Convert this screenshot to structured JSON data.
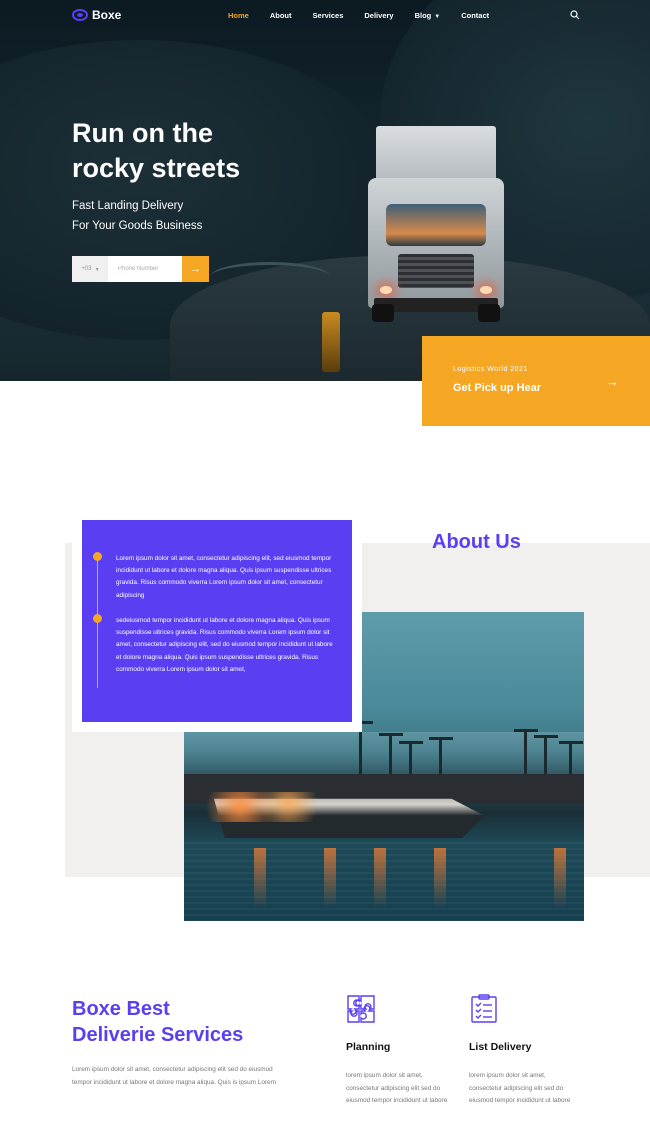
{
  "brand": {
    "name": "Boxe",
    "accent": "#5a3ff2",
    "highlight": "#f5a623"
  },
  "nav": {
    "items": [
      {
        "label": "Home",
        "active": true
      },
      {
        "label": "About"
      },
      {
        "label": "Services"
      },
      {
        "label": "Delivery"
      },
      {
        "label": "Blog",
        "dropdown": true
      },
      {
        "label": "Contact"
      }
    ],
    "search_icon": "search-icon"
  },
  "hero": {
    "title_line1": "Run on the",
    "title_line2": "rocky streets",
    "subtitle_line1": "Fast Landing Delivery",
    "subtitle_line2": "For Your Goods Business",
    "country_code": "+03",
    "phone_placeholder": "Phone Number",
    "submit_icon": "arrow-right-icon"
  },
  "pickup": {
    "kicker": "Logistics World 2021",
    "title": "Get Pick up Hear",
    "icon": "arrow-right-icon"
  },
  "about": {
    "heading": "About Us",
    "paragraph1": "Lorem ipsum dolor sit amet, consectetur adipiscing elit, sed eiusmod tempor incididunt ut labore et dolore magna aliqua. Quis ipsum suspendisse ultrices gravida. Risus commodo viverra Lorem ipsum dolor sit amet, consectetur adipiscing",
    "paragraph2": "sedeiusmod tempor incididunt ut labore et dolore magna aliqua. Quis ipsum suspendisse ultrices gravida. Risus commodo viverra Lorem ipsum dolor sit amet, consectetur adipiscing elit, sed do eiusmod tempor incididunt ut labore et dolore magna aliqua. Quis ipsum suspendisse ultrices gravida. Risus commodo viverra Lorem ipsum dolor sit amet,"
  },
  "services": {
    "title_line1": "Boxe Best",
    "title_line2": "Deliverie Services",
    "description": "Lorem ipsum dolor sit amet, consectetur adipiscing elit sed do eiusmod tempor incididunt ut labore et dolore magna aliqua. Quis is ipsum Lorem",
    "features": [
      {
        "icon": "puzzle-icon",
        "title": "Planning",
        "text": "lorem ipsum dolor sit amet, consectetur adipiscing elit sed do eiusmod tempor incididunt ut labore"
      },
      {
        "icon": "checklist-icon",
        "title": "List Delivery",
        "text": "lorem ipsum dolor sit amet, consectetur adipiscing elit sed do eiusmod tempor incididunt ut labore"
      }
    ]
  }
}
